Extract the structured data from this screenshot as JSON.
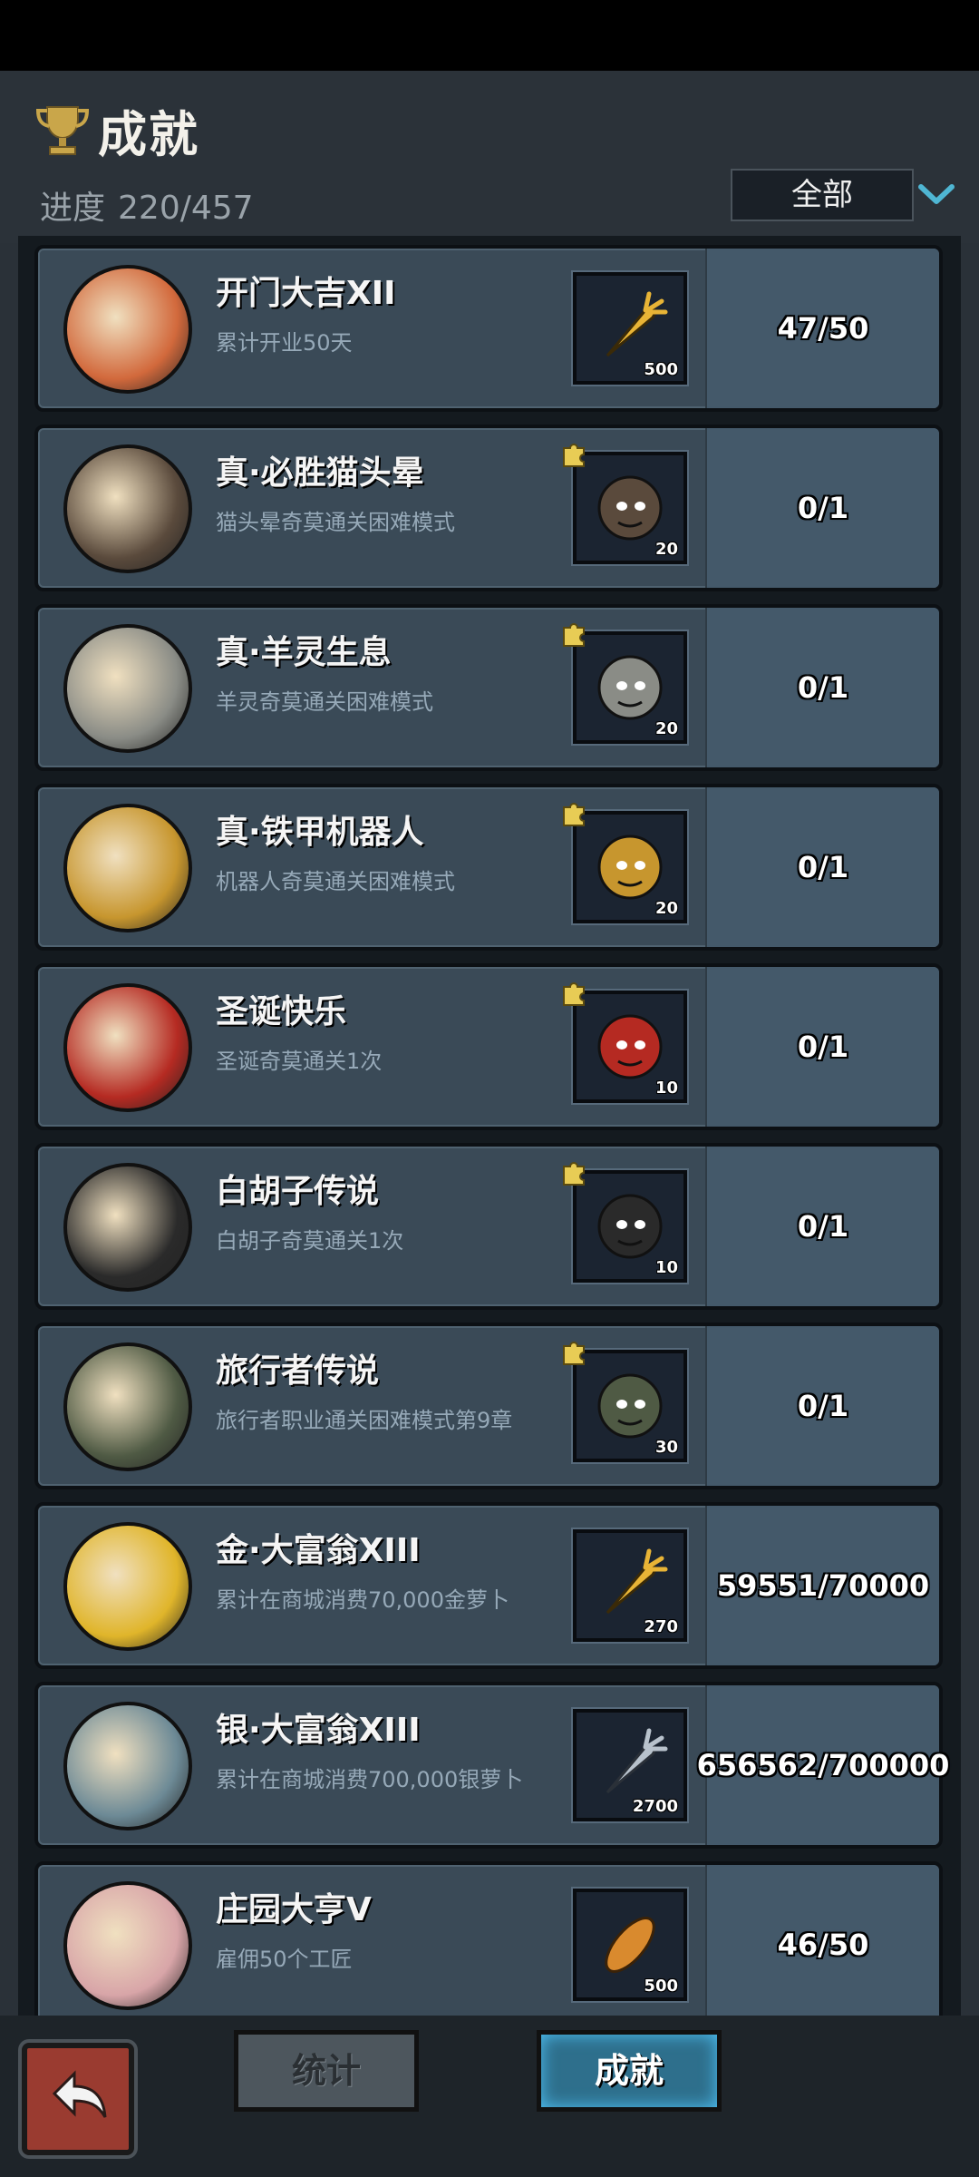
{
  "header": {
    "title": "成就",
    "progress_label": "进度",
    "progress_value": "220/457",
    "filter_selected": "全部"
  },
  "achievements": [
    {
      "name": "开门大吉XII",
      "desc": "累计开业50天",
      "reward_qty": "500",
      "reward_icon": "gold-carrot-icon",
      "progress": "47/50",
      "puzzle": false,
      "avatar_color": "#d2693c"
    },
    {
      "name": "真·必胜猫头晕",
      "desc": "猫头晕奇莫通关困难模式",
      "reward_qty": "20",
      "reward_icon": "cat-head-portrait-icon",
      "progress": "0/1",
      "puzzle": true,
      "avatar_color": "#5a4a3c"
    },
    {
      "name": "真·羊灵生息",
      "desc": "羊灵奇莫通关困难模式",
      "reward_qty": "20",
      "reward_icon": "sheep-skull-portrait-icon",
      "progress": "0/1",
      "puzzle": true,
      "avatar_color": "#8a8c86"
    },
    {
      "name": "真·铁甲机器人",
      "desc": "机器人奇莫通关困难模式",
      "reward_qty": "20",
      "reward_icon": "robot-head-portrait-icon",
      "progress": "0/1",
      "puzzle": true,
      "avatar_color": "#c7962e"
    },
    {
      "name": "圣诞快乐",
      "desc": "圣诞奇莫通关1次",
      "reward_qty": "10",
      "reward_icon": "santa-portrait-icon",
      "progress": "0/1",
      "puzzle": true,
      "avatar_color": "#b52a22"
    },
    {
      "name": "白胡子传说",
      "desc": "白胡子奇莫通关1次",
      "reward_qty": "10",
      "reward_icon": "masked-man-portrait-icon",
      "progress": "0/1",
      "puzzle": true,
      "avatar_color": "#2a2a2a"
    },
    {
      "name": "旅行者传说",
      "desc": "旅行者职业通关困难模式第9章",
      "reward_qty": "30",
      "reward_icon": "hooded-traveler-portrait-icon",
      "progress": "0/1",
      "puzzle": true,
      "avatar_color": "#4f5a44"
    },
    {
      "name": "金·大富翁XIII",
      "desc": "累计在商城消费70,000金萝卜",
      "reward_qty": "270",
      "reward_icon": "gold-carrot-icon",
      "progress": "59551/70000",
      "puzzle": false,
      "avatar_color": "#e0b52a"
    },
    {
      "name": "银·大富翁XIII",
      "desc": "累计在商城消费700,000银萝卜",
      "reward_qty": "2700",
      "reward_icon": "silver-carrot-icon",
      "progress": "656562/700000",
      "puzzle": false,
      "avatar_color": "#6d8a96"
    },
    {
      "name": "庄园大亨V",
      "desc": "雇佣50个工匠",
      "reward_qty": "500",
      "reward_icon": "bread-icon",
      "progress": "46/50",
      "puzzle": false,
      "avatar_color": "#d8a5a8"
    }
  ],
  "bottom_tabs": {
    "stats": "统计",
    "achievements": "成就"
  },
  "colors": {
    "background": "#2a3138",
    "card": "#3a4a57",
    "accent_cyan": "#4fb6d3",
    "tab_active": "#2e6f8c",
    "back_button": "#9a3b30"
  }
}
